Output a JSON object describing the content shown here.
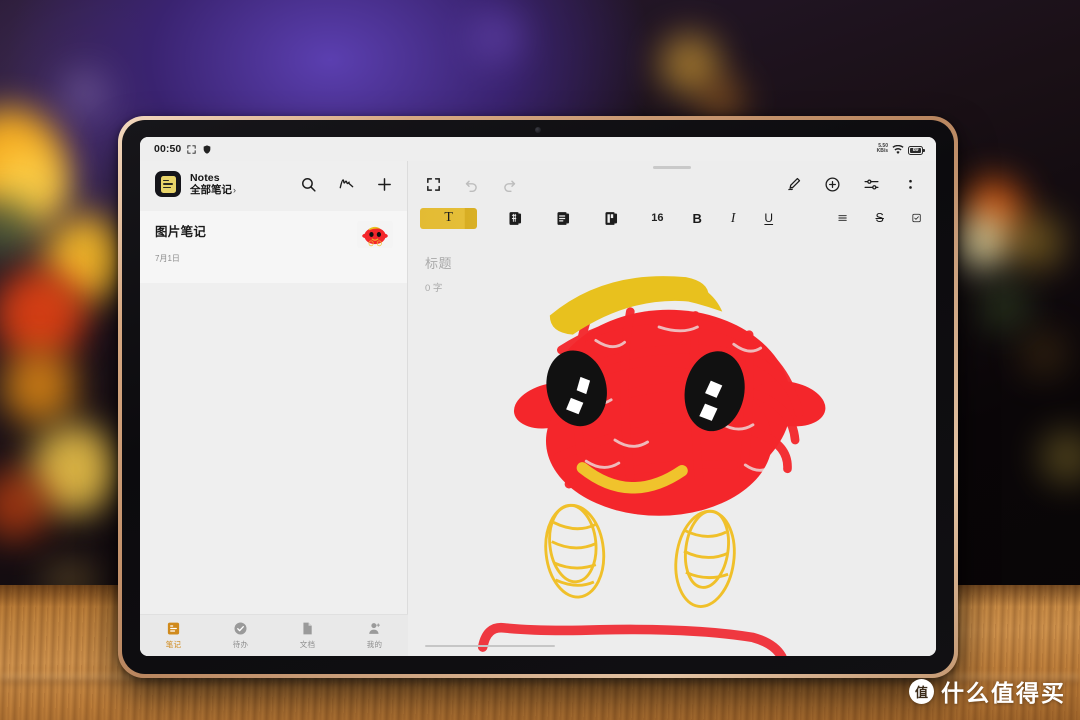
{
  "statusbar": {
    "time": "00:50",
    "icons": [
      "screenshot-icon",
      "shield-icon"
    ],
    "net_speed_line1": "5.50",
    "net_speed_line2": "KB/s",
    "battery_percent": "89"
  },
  "left_pane": {
    "app_name": "Notes",
    "folder": "全部笔记",
    "folder_chevron": "›",
    "actions": [
      {
        "name": "search-icon",
        "label": "搜索"
      },
      {
        "name": "handwriting-icon",
        "label": "手写"
      },
      {
        "name": "add-note-icon",
        "label": "新建"
      }
    ],
    "notes": [
      {
        "title": "图片笔记",
        "date": "7月1日",
        "has_thumbnail": true
      }
    ]
  },
  "bottom_nav": {
    "items": [
      {
        "label": "笔记",
        "icon": "notes-icon",
        "active": true
      },
      {
        "label": "待办",
        "icon": "check-circle-icon",
        "active": false
      },
      {
        "label": "文档",
        "icon": "document-icon",
        "active": false
      },
      {
        "label": "我的",
        "icon": "person-icon",
        "active": false
      }
    ]
  },
  "editor": {
    "toolbar_left": [
      {
        "name": "expand-icon",
        "label": "全屏",
        "enabled": true
      },
      {
        "name": "undo-icon",
        "label": "撤销",
        "enabled": false
      },
      {
        "name": "redo-icon",
        "label": "重做",
        "enabled": false
      }
    ],
    "toolbar_right": [
      {
        "name": "pen-edit-icon",
        "label": "手写"
      },
      {
        "name": "plus-circle-icon",
        "label": "插入"
      },
      {
        "name": "sliders-icon",
        "label": "设置"
      },
      {
        "name": "more-vertical-icon",
        "label": "更多"
      }
    ],
    "format_bar": {
      "text_tool_label": "T",
      "tools": [
        {
          "name": "grid-note-icon",
          "label": "网格"
        },
        {
          "name": "lined-note-icon",
          "label": "横线"
        },
        {
          "name": "layout-note-icon",
          "label": "版式"
        }
      ],
      "font_size": "16",
      "bold_label": "B",
      "italic_label": "I",
      "underline_label": "U",
      "color_label": "color-wheel-icon",
      "align_label": "align-icon",
      "strikethrough_label": "S",
      "checkbox_label": "checkbox-icon"
    },
    "title_placeholder": "标题",
    "word_count": "0 字"
  },
  "drawing": {
    "description": "child-drawing-red-creature",
    "body_color": "#f4262b",
    "hair_color": "#e8c11e",
    "eye_color": "#111111",
    "foot_color": "#f0c02a",
    "smile_color": "#f0c32c"
  },
  "watermark": {
    "badge": "值",
    "text": "什么值得买"
  },
  "colors": {
    "accent_yellow": "#e3bb33",
    "nav_active": "#d08a1c",
    "screen_bg": "#ededed",
    "bezel": "#d6a882"
  }
}
